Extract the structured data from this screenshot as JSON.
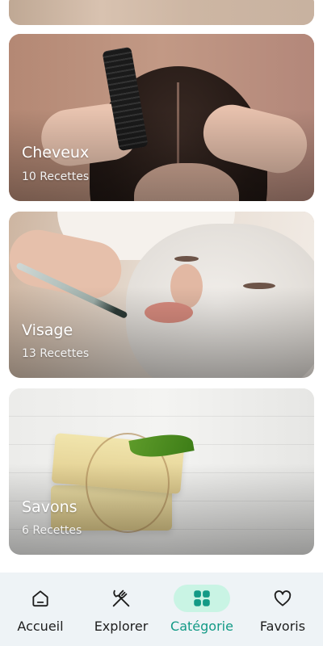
{
  "categories": [
    {
      "title": "Cheveux",
      "count": "10 Recettes"
    },
    {
      "title": "Visage",
      "count": "13 Recettes"
    },
    {
      "title": "Savons",
      "count": "6 Recettes"
    }
  ],
  "bottom_nav": {
    "items": [
      {
        "label": "Accueil",
        "icon": "home-icon"
      },
      {
        "label": "Explorer",
        "icon": "fork-knife-icon"
      },
      {
        "label": "Catégorie",
        "icon": "grid-icon"
      },
      {
        "label": "Favoris",
        "icon": "heart-icon"
      }
    ],
    "active": "Catégorie",
    "colors": {
      "active": "#139a86",
      "active_pill": "#c9f4e4",
      "background": "#eef3f6"
    }
  }
}
